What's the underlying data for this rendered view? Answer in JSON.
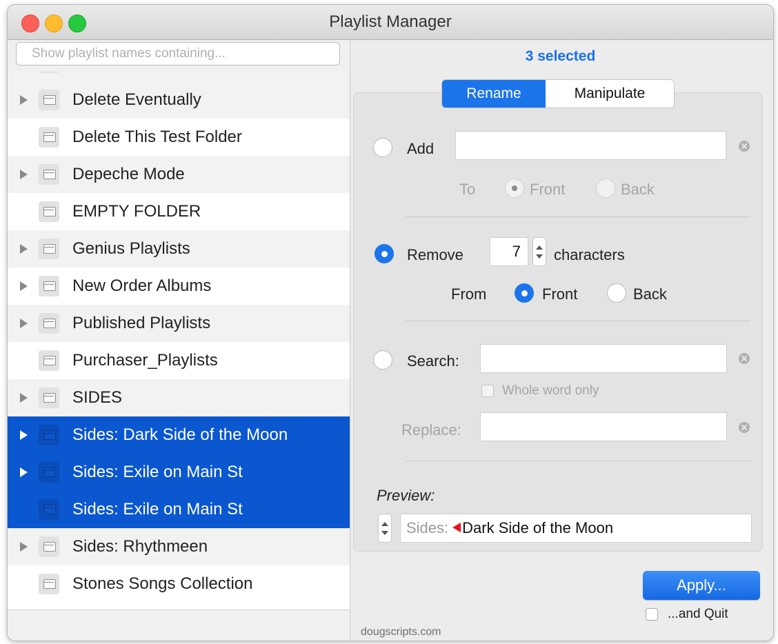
{
  "window": {
    "title": "Playlist Manager"
  },
  "sidebar": {
    "filter_placeholder": "Show playlist names containing...",
    "items": [
      {
        "label": "Delete Eventually",
        "expandable": true,
        "selected": false
      },
      {
        "label": "Delete This Test Folder",
        "expandable": false,
        "selected": false
      },
      {
        "label": "Depeche Mode",
        "expandable": true,
        "selected": false
      },
      {
        "label": "EMPTY FOLDER",
        "expandable": false,
        "selected": false
      },
      {
        "label": "Genius Playlists",
        "expandable": true,
        "selected": false
      },
      {
        "label": "New Order Albums",
        "expandable": true,
        "selected": false
      },
      {
        "label": "Published Playlists",
        "expandable": true,
        "selected": false
      },
      {
        "label": "Purchaser_Playlists",
        "expandable": false,
        "selected": false
      },
      {
        "label": "SIDES",
        "expandable": true,
        "selected": false
      },
      {
        "label": "Sides: Dark Side of the Moon",
        "expandable": true,
        "selected": true
      },
      {
        "label": "Sides: Exile on Main St",
        "expandable": true,
        "selected": true
      },
      {
        "label": "Sides: Exile on Main St",
        "expandable": false,
        "selected": true
      },
      {
        "label": "Sides: Rhythmeen",
        "expandable": true,
        "selected": false
      },
      {
        "label": "Stones Songs Collection",
        "expandable": false,
        "selected": false
      }
    ]
  },
  "main": {
    "selected_count": "3 selected",
    "tabs": [
      {
        "label": "Rename",
        "active": true
      },
      {
        "label": "Manipulate",
        "active": false
      }
    ],
    "add": {
      "label": "Add",
      "value": "",
      "to_label": "To",
      "front_label": "Front",
      "back_label": "Back"
    },
    "remove": {
      "label": "Remove",
      "count": "7",
      "unit_label": "characters",
      "from_label": "From",
      "front_label": "Front",
      "back_label": "Back"
    },
    "search": {
      "label": "Search:",
      "value": "",
      "whole_word_label": "Whole word only",
      "replace_label": "Replace:",
      "replace_value": ""
    },
    "preview": {
      "label": "Preview:",
      "prefix": "Sides:",
      "result": "Dark Side of the Moon"
    },
    "apply_label": "Apply...",
    "quit_label": "...and Quit"
  },
  "footer": {
    "text": "dougscripts.com"
  },
  "colors": {
    "accent": "#1c74ea",
    "selection": "#0a57d0",
    "marker": "#e8141c"
  }
}
